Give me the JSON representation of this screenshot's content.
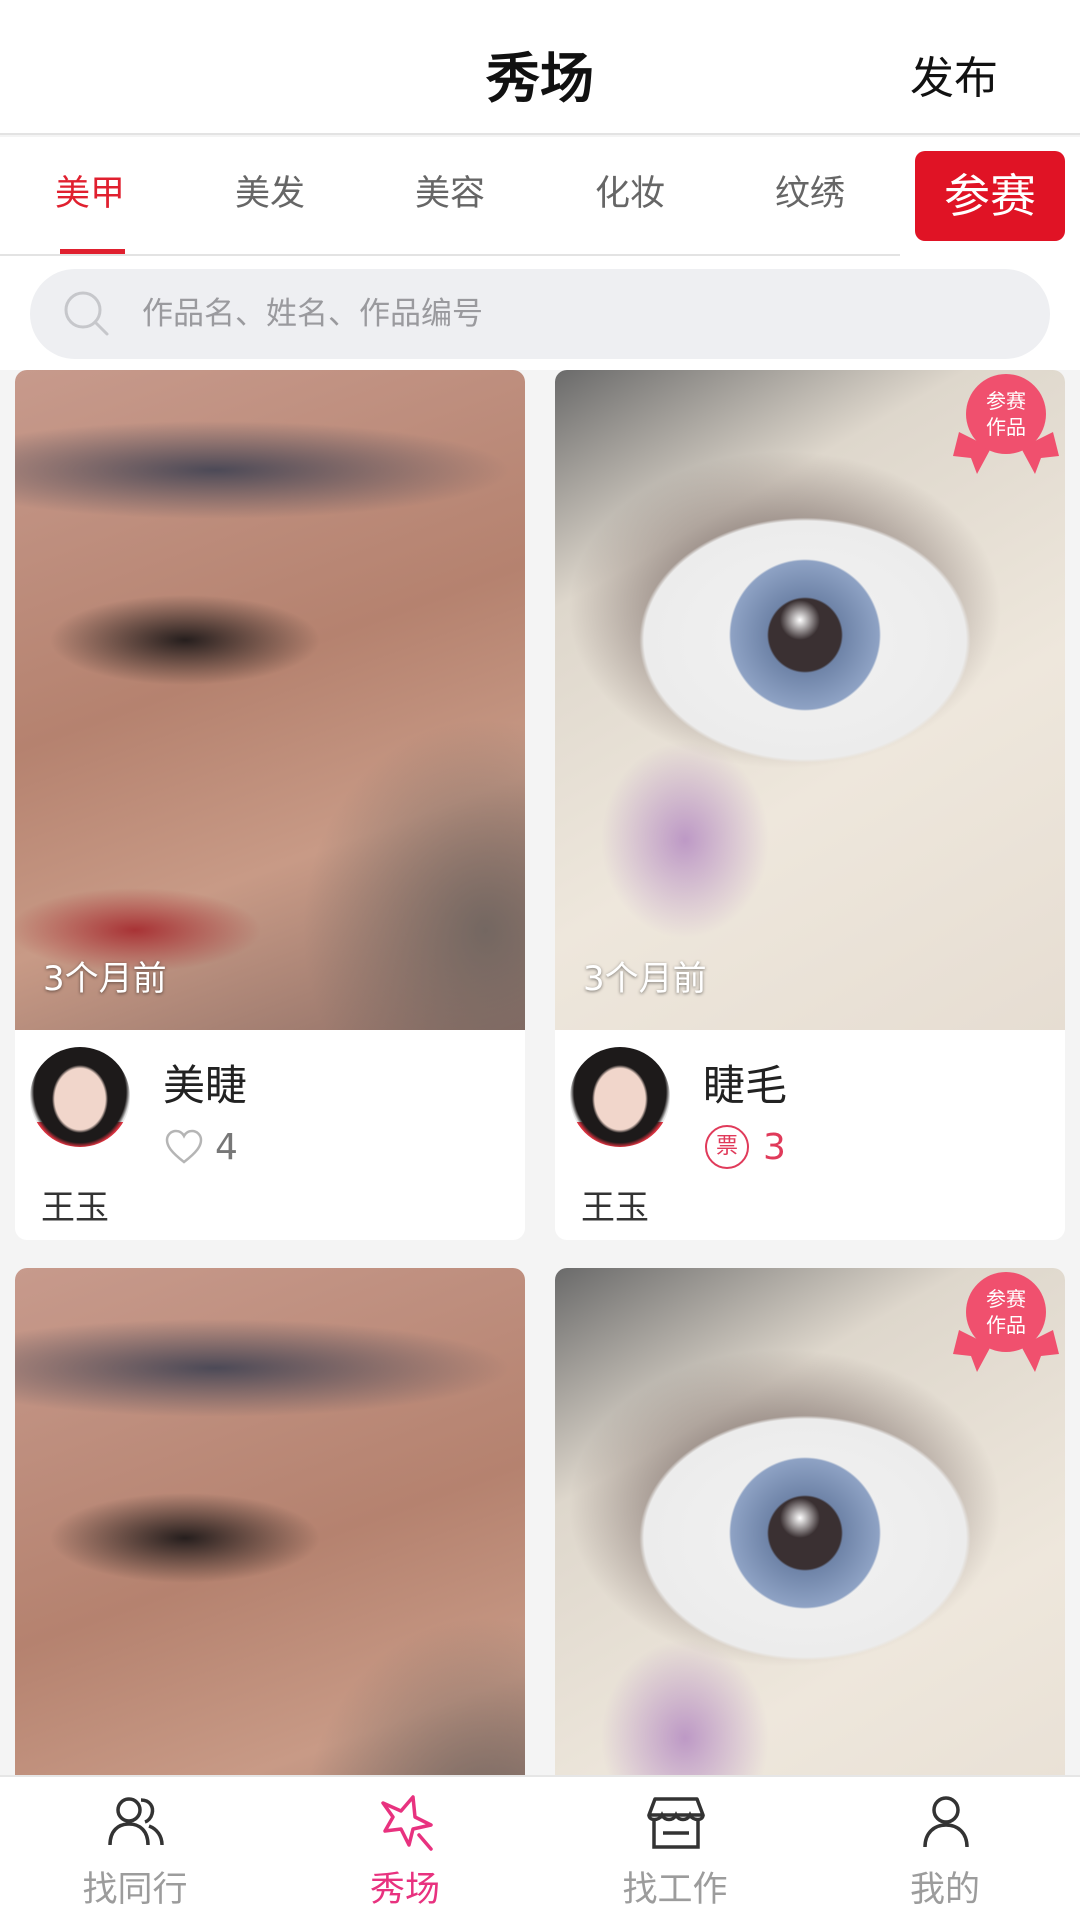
{
  "header": {
    "title": "秀场",
    "publish_label": "发布"
  },
  "tabs": [
    {
      "label": "美甲",
      "active": true
    },
    {
      "label": "美发",
      "active": false
    },
    {
      "label": "美容",
      "active": false
    },
    {
      "label": "化妆",
      "active": false
    },
    {
      "label": "纹绣",
      "active": false
    }
  ],
  "compete_button": "参赛",
  "search": {
    "placeholder": "作品名、姓名、作品编号",
    "value": ""
  },
  "cards": [
    {
      "time": "3个月前",
      "title": "美睫",
      "stat_type": "likes",
      "count": "4",
      "author": "王玉",
      "entry_badge": false
    },
    {
      "time": "3个月前",
      "title": "睫毛",
      "stat_type": "votes",
      "vote_icon_text": "票",
      "count": "3",
      "author": "王玉",
      "entry_badge": true,
      "badge_text": [
        "参赛",
        "作品"
      ]
    },
    {
      "entry_badge": false
    },
    {
      "entry_badge": true,
      "badge_text": [
        "参赛",
        "作品"
      ]
    }
  ],
  "bottom_nav": [
    {
      "label": "找同行",
      "icon": "users-icon",
      "active": false
    },
    {
      "label": "秀场",
      "icon": "star-icon",
      "active": true
    },
    {
      "label": "找工作",
      "icon": "store-icon",
      "active": false
    },
    {
      "label": "我的",
      "icon": "person-icon",
      "active": false
    }
  ],
  "colors": {
    "accent_red": "#e0202f",
    "active_nav_pink": "#e8327f",
    "vote_pink": "#e03a5a"
  }
}
